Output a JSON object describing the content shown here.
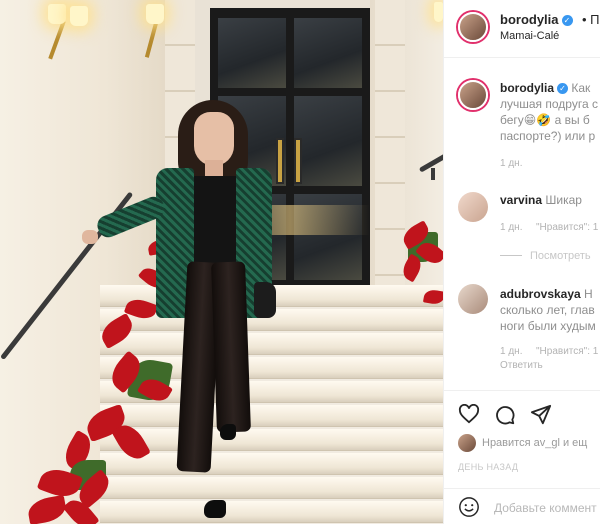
{
  "post": {
    "author": "borodylia",
    "location": "Mamai-Calé",
    "header_suffix": "• Под"
  },
  "comments": [
    {
      "username": "borodylia",
      "lines": [
        "borodylia  Как",
        "лучшая подруга с",
        "бегу😁🤣  а вы б",
        "паспорте?) или р"
      ],
      "time": "1 дн."
    },
    {
      "username": "varvina",
      "lines": [
        "varvina  Шикар"
      ],
      "time": "1 дн.",
      "like_label": "\"Нравится\": 1",
      "view_replies": "Посмотреть"
    },
    {
      "username": "adubrovskaya",
      "lines": [
        "adubrovskaya  Н",
        "сколько лет, глав",
        "ноги были худым"
      ],
      "time": "1 дн.",
      "like_label": "\"Нравится\": 1",
      "reply_label": "Ответить"
    }
  ],
  "actions": {
    "like_icon": "heart-icon",
    "comment_icon": "speech-bubble-icon",
    "share_icon": "paper-plane-icon"
  },
  "likes_text": "Нравится av_gl и ещ",
  "time_ago": "ДЕНЬ НАЗАД",
  "add_comment_placeholder": "Добавьте коммент",
  "emoji_icon": "smiley-icon"
}
